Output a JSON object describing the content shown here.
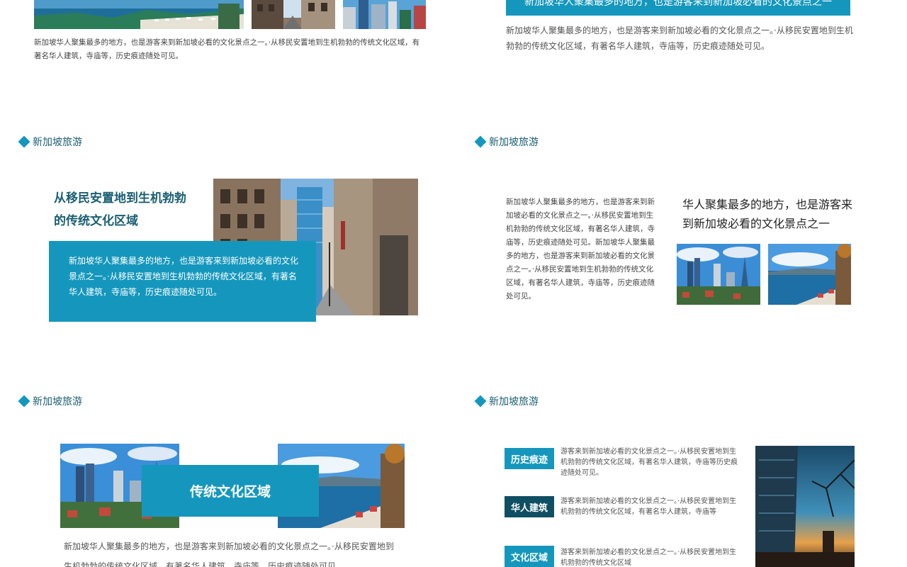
{
  "colors": {
    "accent": "#1597bd",
    "dark": "#0f4e63",
    "title": "#1a5e73"
  },
  "slide1": {
    "paragraph": "新加坡华人聚集最多的地方，也是游客来到新加坡必看的文化景点之一。·从移民安置地到生机勃勃的传统文化区域，有著名华人建筑，寺庙等，历史痕迹随处可见。"
  },
  "slide2": {
    "banner": "新加坡华人聚集最多的地方，也是游客来到新加坡必看的文化景点之一",
    "paragraph": "新加坡华人聚集最多的地方，也是游客来到新加坡必看的文化景点之一。·从移民安置地到生机勃勃的传统文化区域，有著名华人建筑，寺庙等，历史痕迹随处可见。"
  },
  "slide3": {
    "section": "新加坡旅游",
    "heading_line1": "从移民安置地到生机勃勃",
    "heading_line2": "的传统文化区域",
    "box_text": "新加坡华人聚集最多的地方，也是游客来到新加坡必看的文化景点之一。·从移民安置地到生机勃勃的传统文化区域，有著名华人建筑，寺庙等，历史痕迹随处可见。"
  },
  "slide4": {
    "section": "新加坡旅游",
    "paragraph": "新加坡华人聚集最多的地方，也是游客来到新加坡必看的文化景点之一。·从移民安置地到生机勃勃的传统文化区域，有著名华人建筑，寺庙等，历史痕迹随处可见。新加坡华人聚集最多的地方，也是游客来到新加坡必看的文化景点之一。·从移民安置地到生机勃勃的传统文化区域，有著名华人建筑，寺庙等，历史痕迹随处可见。",
    "heading": "华人聚集最多的地方，也是游客来到新加坡必看的文化景点之一"
  },
  "slide5": {
    "section": "新加坡旅游",
    "center_label": "传统文化区域",
    "paragraph": "新加坡华人聚集最多的地方，也是游客来到新加坡必看的文化景点之一。·从移民安置地到生机勃勃的传统文化区域，有著名华人建筑，寺庙等，历史痕迹随处可见。"
  },
  "slide6": {
    "section": "新加坡旅游",
    "items": [
      {
        "tag": "历史痕迹",
        "text": "游客来到新加坡必看的文化景点之一。·从移民安置地到生机勃勃的传统文化区域，有著名华人建筑，寺庙等历史痕迹随处可见。"
      },
      {
        "tag": "华人建筑",
        "text": "游客来到新加坡必看的文化景点之一。·从移民安置地到生机勃勃的传统文化区域，有著名华人建筑，寺庙等"
      },
      {
        "tag": "文化区域",
        "text": "游客来到新加坡必看的文化景点之一。·从移民安置地到生机勃勃的传统文化区域"
      }
    ]
  }
}
